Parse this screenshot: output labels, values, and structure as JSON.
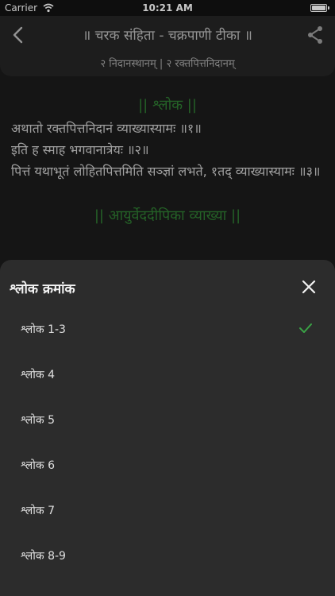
{
  "status_bar": {
    "carrier": "Carrier",
    "time": "10:21 AM",
    "battery_level": 1.0
  },
  "header": {
    "title": "॥ चरक संहिता - चक्रपाणी टीका ॥",
    "subtitle": "२ निदानस्थानम् | २ रक्तपित्तनिदानम्",
    "icons": {
      "back": "chevron-left-icon",
      "share": "share-icon"
    }
  },
  "content": {
    "sections": [
      {
        "heading": "|| श्लोक ||",
        "lines": [
          "अथातो रक्तपित्तनिदानं व्याख्यास्यामः ॥१॥",
          "इति ह स्माह भगवानात्रेयः ॥२॥",
          "पित्तं यथाभूतं लोहितपित्तमिति सञ्ज्ञां लभते, १तद् व्याख्यास्यामः ॥३॥"
        ]
      },
      {
        "heading": "|| आयुर्वेददीपिका व्याख्या ||"
      }
    ]
  },
  "sheet": {
    "title": "श्लोक क्रमांक",
    "close_icon": "close-icon",
    "selected_index": 0,
    "options": [
      {
        "label": "श्लोक 1-3"
      },
      {
        "label": "श्लोक 4"
      },
      {
        "label": "श्लोक 5"
      },
      {
        "label": "श्लोक 6"
      },
      {
        "label": "श्लोक 7"
      },
      {
        "label": "श्लोक 8-9"
      }
    ]
  },
  "colors": {
    "accent_green": "#2f7d32",
    "check_green": "#3aa346",
    "sheet_bg": "#2c2c2c"
  }
}
